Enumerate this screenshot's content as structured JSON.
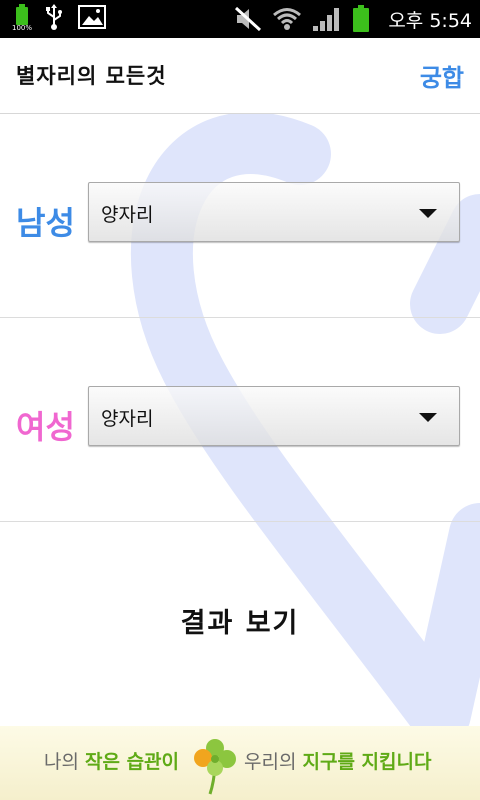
{
  "status_bar": {
    "battery_small_pct": "100%",
    "time": "오후 5:54",
    "icons": [
      "battery-icon",
      "usb-icon",
      "gallery-icon",
      "mute-icon",
      "wifi-icon",
      "signal-icon",
      "battery-icon"
    ],
    "accent": "#3cbf1c"
  },
  "header": {
    "title": "별자리의 모든것",
    "action_label": "궁합",
    "action_color": "#3d8be6"
  },
  "male_row": {
    "label": "남성",
    "label_color": "#3d8be6",
    "selected": "양자리"
  },
  "female_row": {
    "label": "여성",
    "label_color": "#f067d0",
    "selected": "양자리"
  },
  "result": {
    "button_label": "결과 보기"
  },
  "banner": {
    "left_plain": "나의 ",
    "left_highlight": "작은 습관이",
    "right_plain": "우리의 ",
    "right_highlight": "지구를 지킵니다",
    "highlight_color": "#5faa16"
  }
}
